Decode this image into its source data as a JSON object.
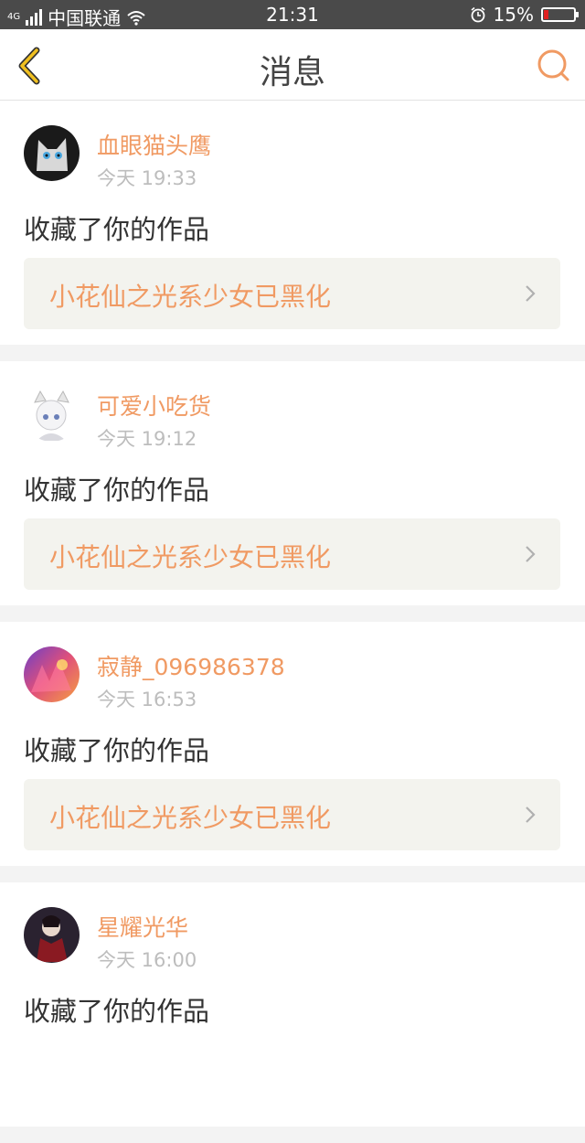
{
  "status_bar": {
    "carrier": "中国联通",
    "network_tag": "4G",
    "time": "21:31",
    "battery": "15%",
    "battery_level": 0.15,
    "icons": [
      "signal-icon",
      "wifi-icon",
      "alarm-icon",
      "battery-icon"
    ]
  },
  "nav": {
    "title": "消息",
    "back_icon": "chevron-left-icon",
    "search_icon": "search-icon",
    "accent": "#f0c020",
    "search_color": "#f09a63"
  },
  "messages": [
    {
      "user": "血眼猫头鹰",
      "time": "今天 19:33",
      "action": "收藏了你的作品",
      "work": "小花仙之光系少女已黑化"
    },
    {
      "user": "可爱小吃货",
      "time": "今天 19:12",
      "action": "收藏了你的作品",
      "work": "小花仙之光系少女已黑化"
    },
    {
      "user": "寂静_096986378",
      "time": "今天 16:53",
      "action": "收藏了你的作品",
      "work": "小花仙之光系少女已黑化"
    },
    {
      "user": "星耀光华",
      "time": "今天 16:00",
      "action": "收藏了你的作品",
      "work": ""
    }
  ],
  "colors": {
    "username": "#f09a63",
    "work_title": "#f09a63",
    "timestamp": "#bdbdbd",
    "card_bg": "#ffffff",
    "page_bg": "#f3f3f3"
  }
}
